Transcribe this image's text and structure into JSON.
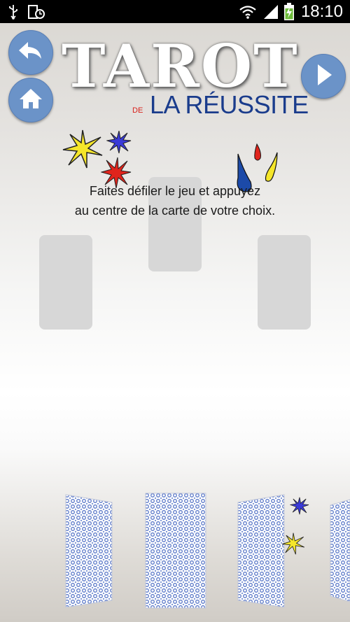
{
  "status_bar": {
    "time": "18:10",
    "icons": [
      "usb-icon",
      "screenshot-icon",
      "wifi-icon",
      "signal-icon",
      "battery-charging-icon"
    ]
  },
  "nav": {
    "back_icon": "back-arrow-icon",
    "home_icon": "home-icon",
    "next_icon": "play-next-icon",
    "button_color": "#6b93c8"
  },
  "header": {
    "title": "TAROT",
    "subtitle_prefix": "DE",
    "subtitle": "LA RÉUSSITE"
  },
  "colors": {
    "title_blue": "#1a3c8c",
    "accent_red": "#d8211b",
    "card_pattern": "#5a78c8"
  },
  "instruction": {
    "line1": "Faites défiler le jeu et appuyez",
    "line2": "au centre de la carte de votre choix."
  },
  "slots": [
    "slot-left",
    "slot-center",
    "slot-right"
  ],
  "deck": [
    "card-1",
    "card-2",
    "card-3",
    "card-4"
  ]
}
